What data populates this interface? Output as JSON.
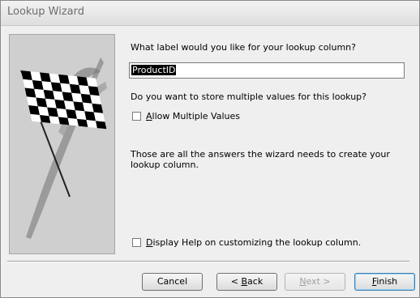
{
  "window": {
    "title": "Lookup Wizard"
  },
  "wizard": {
    "label_question": "What label would you like for your lookup column?",
    "label_value": "ProductID",
    "multi_question": "Do you want to store multiple values for this lookup?",
    "allow_multiple": {
      "label_accel": "A",
      "label_rest": "llow Multiple Values",
      "checked": false
    },
    "info_text": "Those are all the answers the wizard needs to create your lookup column.",
    "help_checkbox": {
      "label_accel": "D",
      "label_rest": "isplay Help on customizing the lookup column.",
      "checked": false
    },
    "image_icon": "checkered-flag-icon"
  },
  "buttons": {
    "cancel": "Cancel",
    "back_prefix": "< ",
    "back_accel": "B",
    "back_rest": "ack",
    "next_accel": "N",
    "next_rest": "ext >",
    "finish_accel": "F",
    "finish_rest": "inish"
  }
}
